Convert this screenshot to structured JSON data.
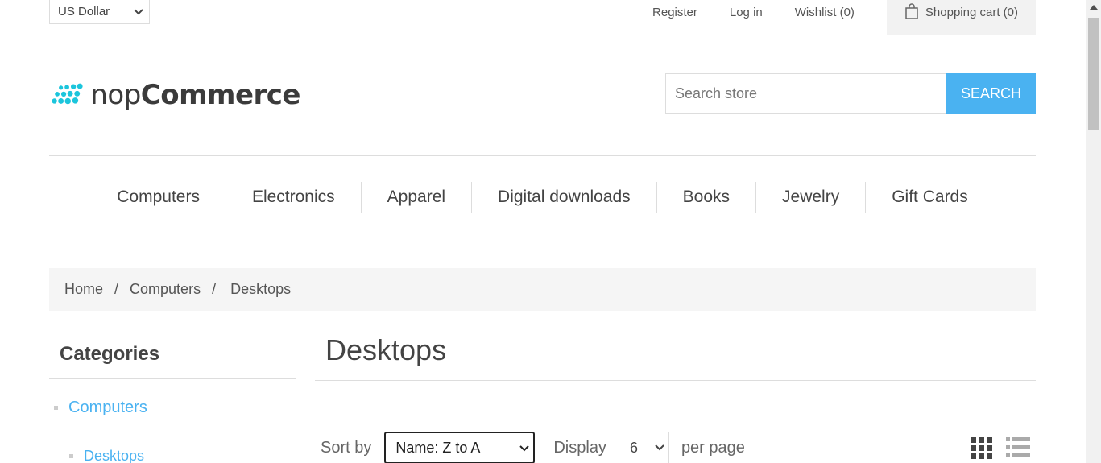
{
  "header": {
    "currency": "US Dollar",
    "register": "Register",
    "login": "Log in",
    "wishlist": "Wishlist (0)",
    "cart": "Shopping cart (0)"
  },
  "logo": {
    "prefix": "nop",
    "suffix": "Commerce"
  },
  "search": {
    "placeholder": "Search store",
    "button": "SEARCH"
  },
  "menu": [
    "Computers",
    "Electronics",
    "Apparel",
    "Digital downloads",
    "Books",
    "Jewelry",
    "Gift Cards"
  ],
  "breadcrumb": {
    "home": "Home",
    "sep": "/",
    "parent": "Computers",
    "current": "Desktops"
  },
  "sidebar": {
    "title": "Categories",
    "items": [
      "Computers",
      "Desktops"
    ]
  },
  "main": {
    "title": "Desktops",
    "sort_label": "Sort by",
    "sort_value": "Name: Z to A",
    "display_label": "Display",
    "display_value": "6",
    "per_page": "per page"
  },
  "colors": {
    "accent": "#4ab2f1",
    "logo": "#1bc5dc"
  },
  "icons": {
    "cart": "shopping-bag-icon",
    "grid": "grid-view-icon",
    "list": "list-view-icon"
  }
}
